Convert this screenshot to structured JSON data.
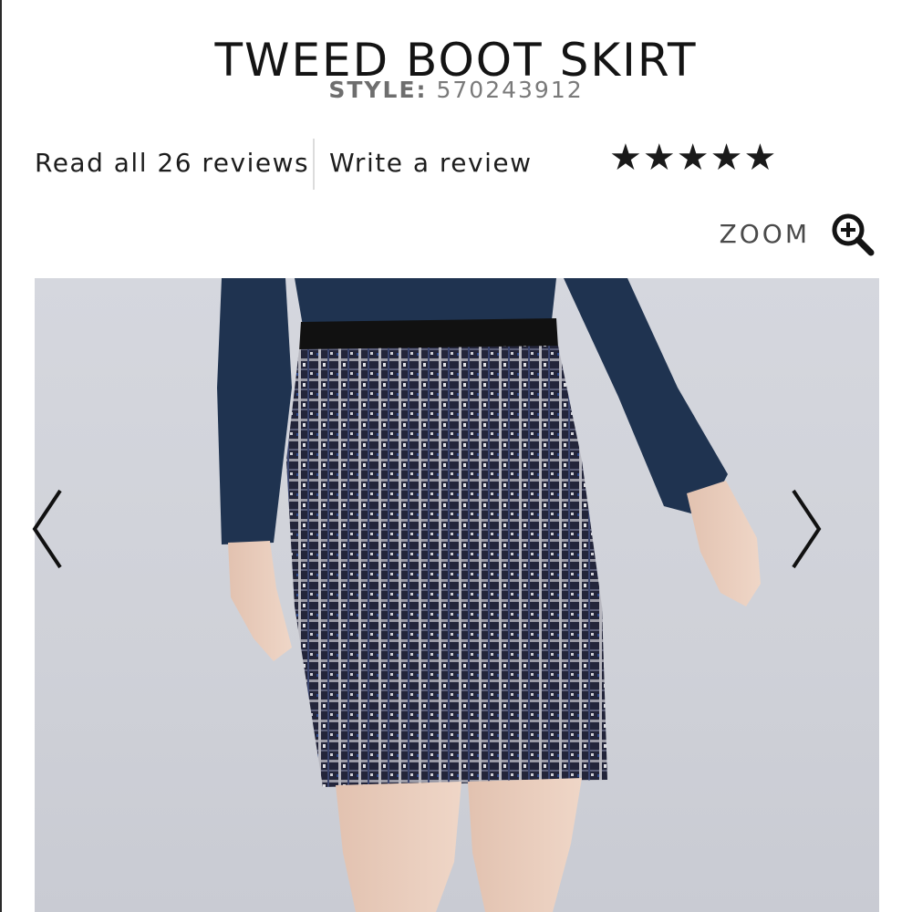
{
  "product": {
    "title": "TWEED BOOT SKIRT",
    "style_label": "STYLE:",
    "style_number": "570243912"
  },
  "reviews": {
    "read_all_label": "Read all 26 reviews",
    "write_label": "Write a review",
    "stars": "★★★★★",
    "rating": 5,
    "rating_max": 5
  },
  "zoom": {
    "label": "ZOOM",
    "icon": "zoom-in-icon"
  },
  "gallery": {
    "prev_icon": "chevron-left-icon",
    "next_icon": "chevron-right-icon",
    "image": "product-photo"
  },
  "colors": {
    "text": "#141414",
    "style_gray": "#7a7a7a",
    "blouse_navy": "#1f3350",
    "photo_background": "#d3d5dc"
  }
}
